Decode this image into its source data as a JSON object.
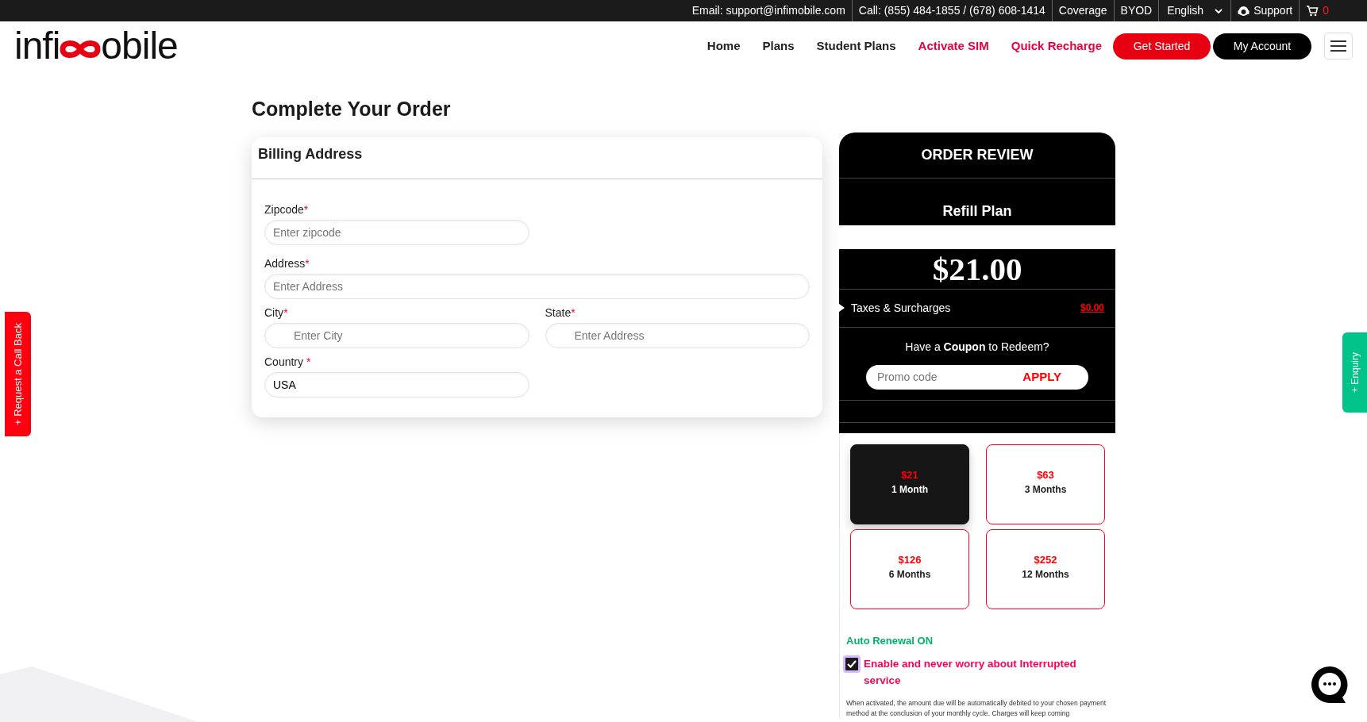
{
  "top_bar": {
    "items": [
      {
        "kind": "text",
        "label": "Email: support@infimobile.com"
      },
      {
        "kind": "text",
        "label": "Call: (855) 484-1855 / (678) 608-1414"
      },
      {
        "kind": "link",
        "label": "Coverage"
      },
      {
        "kind": "link",
        "label": "BYOD"
      },
      {
        "kind": "dropdown",
        "label": "English"
      },
      {
        "kind": "support",
        "label": "Support"
      },
      {
        "kind": "cart",
        "label": "0"
      }
    ]
  },
  "logo": {
    "before": "infi",
    "after": "obile"
  },
  "nav": {
    "links": [
      {
        "label": "Home",
        "highlight": false
      },
      {
        "label": "Plans",
        "highlight": false
      },
      {
        "label": "Student Plans",
        "highlight": false
      },
      {
        "label": "Activate SIM",
        "highlight": true
      },
      {
        "label": "Quick Recharge",
        "highlight": true
      }
    ],
    "buttons": [
      {
        "label": "Get Started",
        "kind": "primary"
      },
      {
        "label": "My Account",
        "kind": "dark"
      }
    ]
  },
  "page_title": "Complete Your Order",
  "billing": {
    "title": "Billing Address",
    "fields": [
      {
        "label": "Zipcode",
        "required": "*",
        "placeholder": "Enter zipcode"
      },
      {
        "label": "Address",
        "required": "*",
        "placeholder": "Enter Address"
      },
      {
        "label": "City",
        "required": "*",
        "placeholder": "Enter City"
      },
      {
        "label": "State",
        "required": "*",
        "placeholder": "Enter Address"
      },
      {
        "label": "Country ",
        "required": "*",
        "value": "USA"
      }
    ]
  },
  "order_review": {
    "title": "ORDER REVIEW",
    "plan_name": "Refill Plan",
    "price": "$21.00",
    "taxes_label": "Taxes & Surcharges",
    "taxes_value": "$0.00",
    "coupon_text": "Have a **Coupon** to Redeem?",
    "promo_placeholder": "Promo code",
    "apply_label": "APPLY",
    "plans": [
      {
        "price": "$21",
        "period": "1 Month",
        "selected": true
      },
      {
        "price": "$63",
        "period": "3 Months",
        "selected": false
      },
      {
        "price": "$126",
        "period": "6 Months",
        "selected": false
      },
      {
        "price": "$252",
        "period": "12 Months",
        "selected": false
      }
    ],
    "auto_renewal": {
      "label": "Auto Renewal ON",
      "checked": true,
      "text": "Enable and never worry about Interrupted service",
      "note": "When activated, the amount due will be automatically debited to your chosen payment method at the conclusion of your monthly cycle. Charges will keep coming"
    }
  },
  "side_tabs": {
    "left": "+ Request a Call Back",
    "right": "+ Enquiry"
  }
}
